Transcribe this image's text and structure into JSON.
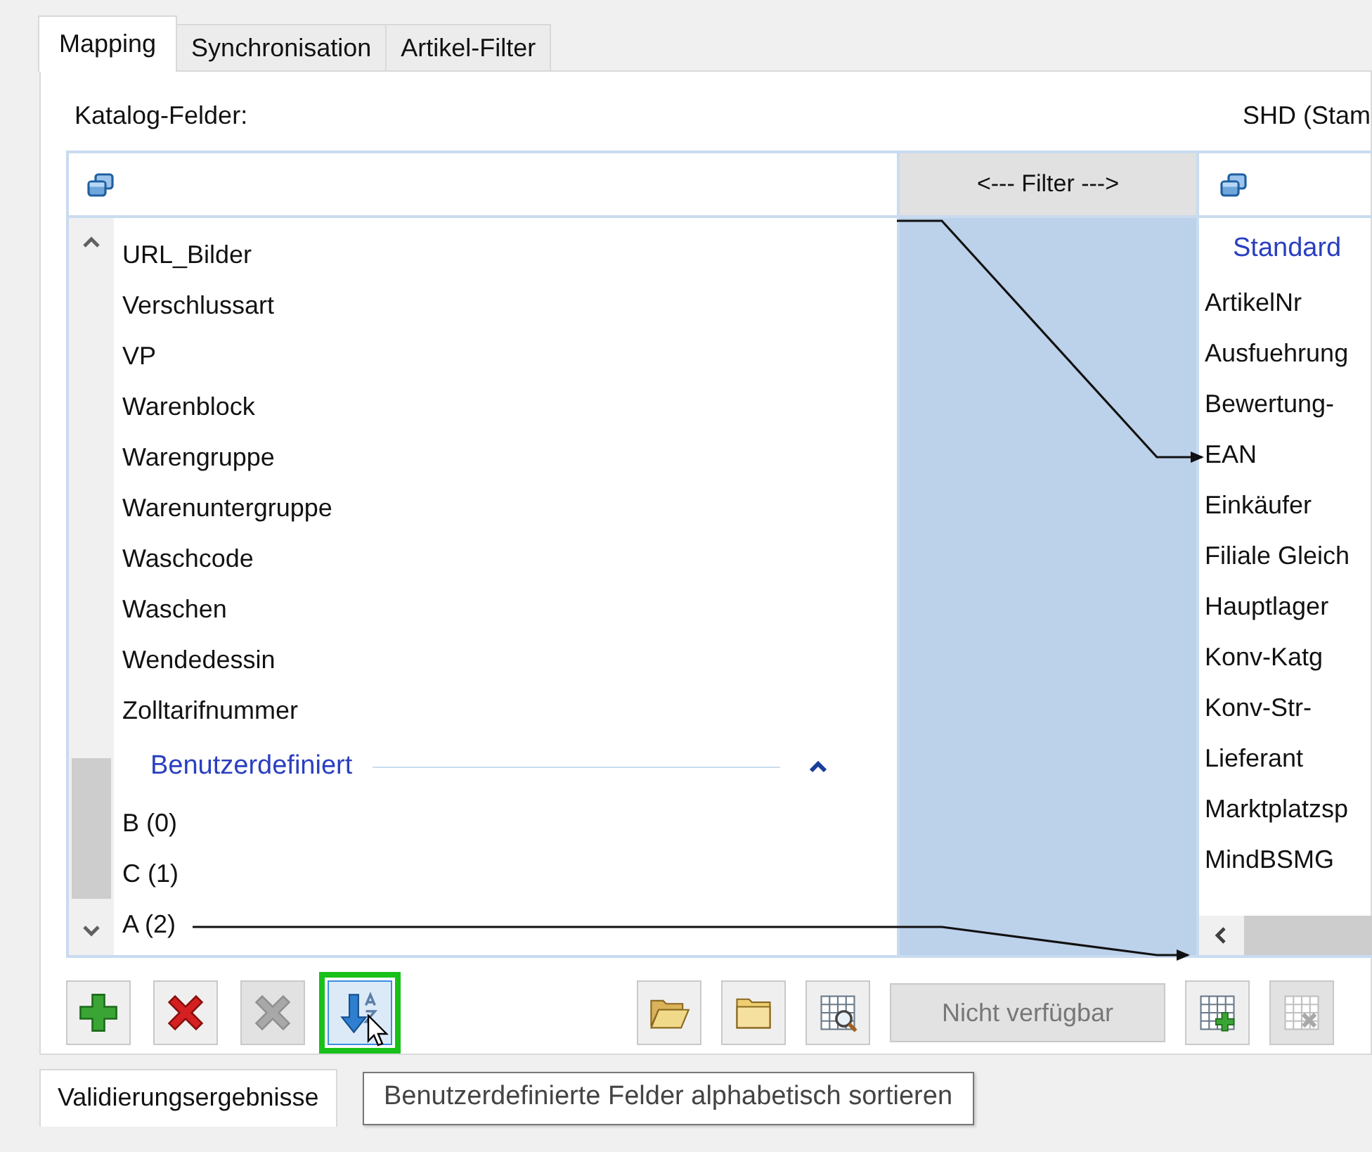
{
  "tabs": [
    {
      "label": "Mapping",
      "selected": true
    },
    {
      "label": "Synchronisation",
      "selected": false
    },
    {
      "label": "Artikel-Filter",
      "selected": false
    }
  ],
  "left_label": "Katalog-Felder:",
  "right_label": "SHD (Stam",
  "filter_header": "<--- Filter --->",
  "left_list": {
    "items": [
      {
        "kind": "item",
        "label": "URL_Bilder",
        "linked": false
      },
      {
        "kind": "item",
        "label": "Verschlussart",
        "linked": false
      },
      {
        "kind": "item",
        "label": "VP",
        "linked": false
      },
      {
        "kind": "item",
        "label": "Warenblock",
        "linked": false
      },
      {
        "kind": "item",
        "label": "Warengruppe",
        "linked": false
      },
      {
        "kind": "item",
        "label": "Warenuntergruppe",
        "linked": false
      },
      {
        "kind": "item",
        "label": "Waschcode",
        "linked": false
      },
      {
        "kind": "item",
        "label": "Waschen",
        "linked": false
      },
      {
        "kind": "item",
        "label": "Wendedessin",
        "linked": false
      },
      {
        "kind": "item",
        "label": "Zolltarifnummer",
        "linked": false
      },
      {
        "kind": "group",
        "label": "Benutzerdefiniert",
        "expanded": true
      },
      {
        "kind": "item",
        "label": "B (0)",
        "linked": false
      },
      {
        "kind": "item",
        "label": "C (1)",
        "linked": false
      },
      {
        "kind": "item",
        "label": "A (2)",
        "linked": true
      }
    ]
  },
  "right_list": {
    "items": [
      {
        "kind": "group",
        "label": "Standard"
      },
      {
        "kind": "item",
        "label": "ArtikelNr",
        "linked": false
      },
      {
        "kind": "item",
        "label": "Ausfuehrung",
        "linked": false
      },
      {
        "kind": "item",
        "label": "Bewertung-",
        "linked": false
      },
      {
        "kind": "item",
        "label": "EAN",
        "linked": true
      },
      {
        "kind": "item",
        "label": "Einkäufer",
        "linked": false
      },
      {
        "kind": "item",
        "label": "Filiale Gleich",
        "linked": false
      },
      {
        "kind": "item",
        "label": "Hauptlager",
        "linked": false
      },
      {
        "kind": "item",
        "label": "Konv-Katg",
        "linked": false
      },
      {
        "kind": "item",
        "label": "Konv-Str-",
        "linked": false
      },
      {
        "kind": "item",
        "label": "Lieferant",
        "linked": false
      },
      {
        "kind": "item",
        "label": "Marktplatzsp",
        "linked": false
      },
      {
        "kind": "item",
        "label": "MindBSMG",
        "linked": false
      }
    ]
  },
  "toolbar_left": [
    {
      "kind": "add",
      "disabled": false,
      "focused": false
    },
    {
      "kind": "delete",
      "disabled": false,
      "focused": false
    },
    {
      "kind": "delete",
      "disabled": true,
      "focused": false
    },
    {
      "kind": "sort",
      "disabled": false,
      "focused": true
    }
  ],
  "toolbar_right": [
    {
      "kind": "folder-open",
      "disabled": false,
      "focused": false
    },
    {
      "kind": "folder",
      "disabled": false,
      "focused": false
    },
    {
      "kind": "grid-search",
      "disabled": false,
      "focused": false
    },
    {
      "kind": "text",
      "label": "Nicht verfügbar",
      "disabled": true,
      "focused": false
    },
    {
      "kind": "grid-add",
      "disabled": false,
      "focused": false
    },
    {
      "kind": "grid-delete",
      "disabled": true,
      "focused": false
    }
  ],
  "bottom_tabs": [
    {
      "label": "Validierungsergebnisse",
      "selected": true
    }
  ],
  "tooltip": "Benutzerdefinierte Felder alphabetisch sortieren"
}
